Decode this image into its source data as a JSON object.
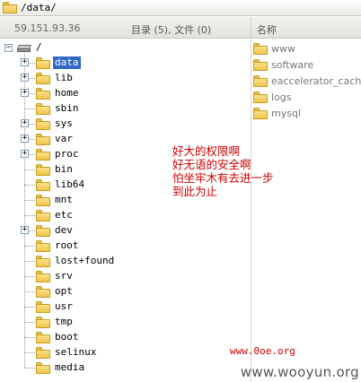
{
  "window": {
    "path": "/data/",
    "path_icon": "folder-icon"
  },
  "header": {
    "ip": "59.151.93.36",
    "summary": "目录 (5), 文件 (0)",
    "column_name": "名称"
  },
  "tree": {
    "root": {
      "label": "/",
      "icon": "drive-icon",
      "expanded": true
    },
    "items": [
      {
        "label": "data",
        "expandable": true,
        "selected": true
      },
      {
        "label": "lib",
        "expandable": true
      },
      {
        "label": "home",
        "expandable": true
      },
      {
        "label": "sbin",
        "expandable": false
      },
      {
        "label": "sys",
        "expandable": true
      },
      {
        "label": "var",
        "expandable": true
      },
      {
        "label": "proc",
        "expandable": true
      },
      {
        "label": "bin",
        "expandable": false
      },
      {
        "label": "lib64",
        "expandable": false
      },
      {
        "label": "mnt",
        "expandable": false
      },
      {
        "label": "etc",
        "expandable": false
      },
      {
        "label": "dev",
        "expandable": true
      },
      {
        "label": "root",
        "expandable": false
      },
      {
        "label": "lost+found",
        "expandable": false
      },
      {
        "label": "srv",
        "expandable": false
      },
      {
        "label": "opt",
        "expandable": false
      },
      {
        "label": "usr",
        "expandable": false
      },
      {
        "label": "tmp",
        "expandable": false
      },
      {
        "label": "boot",
        "expandable": false
      },
      {
        "label": "selinux",
        "expandable": false
      },
      {
        "label": "media",
        "expandable": false
      }
    ]
  },
  "list": {
    "items": [
      {
        "label": "www"
      },
      {
        "label": "software"
      },
      {
        "label": "eaccelerator_cache"
      },
      {
        "label": "logs"
      },
      {
        "label": "mysql"
      }
    ]
  },
  "annotation": {
    "lines": [
      "好大的权限啊",
      "好无语的安全啊",
      "怕坐牢木有去进一步",
      "到此为止"
    ],
    "site": "www.0oe.org",
    "color": "#cc0000"
  },
  "watermark": "www.wooyun.org",
  "colors": {
    "selection": "#316ac5",
    "folder": "#f1c44c"
  }
}
